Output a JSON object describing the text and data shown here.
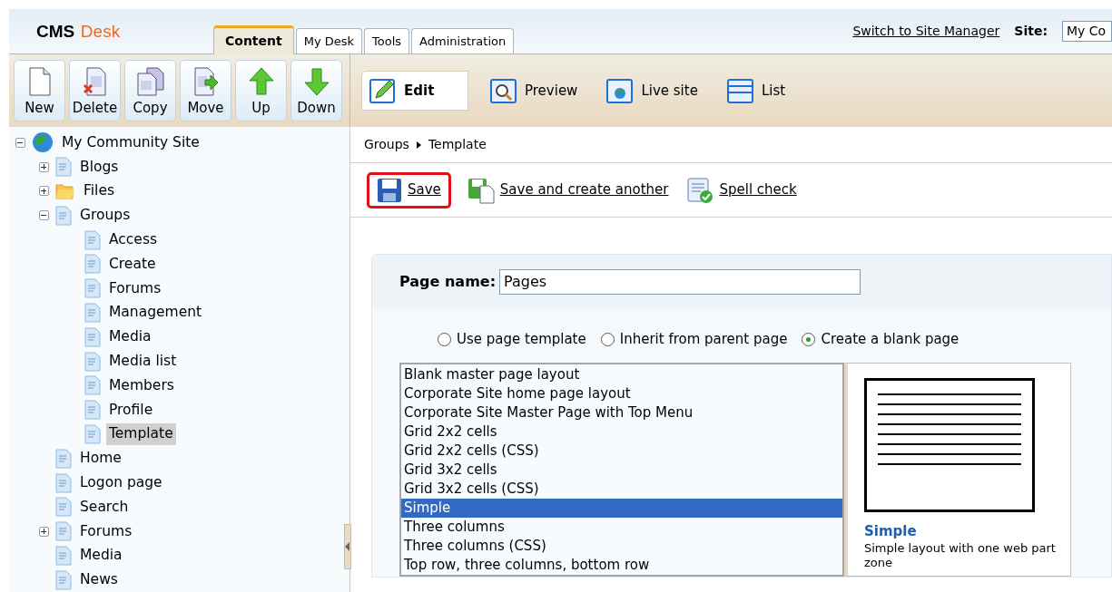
{
  "header": {
    "logo_primary": "CMS",
    "logo_secondary": "Desk",
    "tabs": [
      {
        "label": "Content",
        "selected": true
      },
      {
        "label": "My Desk",
        "selected": false
      },
      {
        "label": "Tools",
        "selected": false
      },
      {
        "label": "Administration",
        "selected": false
      }
    ],
    "switch_link": "Switch to Site Manager",
    "site_label": "Site:",
    "site_value": "My Co"
  },
  "actions": [
    {
      "kind": "new",
      "label": "New"
    },
    {
      "kind": "delete",
      "label": "Delete"
    },
    {
      "kind": "copy",
      "label": "Copy"
    },
    {
      "kind": "move",
      "label": "Move"
    },
    {
      "kind": "up",
      "label": "Up"
    },
    {
      "kind": "down",
      "label": "Down"
    }
  ],
  "view_tabs": [
    {
      "kind": "edit",
      "label": "Edit",
      "selected": true
    },
    {
      "kind": "preview",
      "label": "Preview",
      "selected": false
    },
    {
      "kind": "live",
      "label": "Live site",
      "selected": false
    },
    {
      "kind": "list",
      "label": "List",
      "selected": false
    }
  ],
  "tree": [
    {
      "label": "My Community Site",
      "kind": "globe",
      "expanded": true,
      "selected": false,
      "children": [
        {
          "label": "Blogs",
          "kind": "page",
          "expanded": false,
          "selected": false
        },
        {
          "label": "Files",
          "kind": "folder",
          "expanded": false,
          "selected": false
        },
        {
          "label": "Groups",
          "kind": "page",
          "expanded": true,
          "selected": false,
          "children": [
            {
              "label": "Access",
              "kind": "page",
              "selected": false
            },
            {
              "label": "Create",
              "kind": "page",
              "selected": false
            },
            {
              "label": "Forums",
              "kind": "page",
              "selected": false
            },
            {
              "label": "Management",
              "kind": "page",
              "selected": false
            },
            {
              "label": "Media",
              "kind": "page",
              "selected": false
            },
            {
              "label": "Media list",
              "kind": "page",
              "selected": false
            },
            {
              "label": "Members",
              "kind": "page",
              "selected": false
            },
            {
              "label": "Profile",
              "kind": "page",
              "selected": false
            },
            {
              "label": "Template",
              "kind": "page",
              "selected": true
            }
          ]
        },
        {
          "label": "Home",
          "kind": "page",
          "selected": false
        },
        {
          "label": "Logon page",
          "kind": "page",
          "selected": false
        },
        {
          "label": "Search",
          "kind": "page",
          "selected": false
        },
        {
          "label": "Forums",
          "kind": "page",
          "expanded": false,
          "selected": false
        },
        {
          "label": "Media",
          "kind": "page",
          "selected": false
        },
        {
          "label": "News",
          "kind": "page",
          "selected": false
        }
      ]
    }
  ],
  "breadcrumb": [
    "Groups",
    "Template"
  ],
  "edit_actions": [
    {
      "kind": "save",
      "label": "Save",
      "highlighted": true
    },
    {
      "kind": "save_another",
      "label": "Save and create another",
      "highlighted": false
    },
    {
      "kind": "spell",
      "label": "Spell check",
      "highlighted": false
    }
  ],
  "form": {
    "page_name_label": "Page name:",
    "page_name_value": "Pages",
    "options": [
      {
        "label": "Use page template",
        "selected": false
      },
      {
        "label": "Inherit from parent page",
        "selected": false
      },
      {
        "label": "Create a blank page",
        "selected": true
      }
    ],
    "layouts": [
      {
        "label": "Blank master page layout",
        "selected": false
      },
      {
        "label": "Corporate Site home page layout",
        "selected": false
      },
      {
        "label": "Corporate Site Master Page with Top Menu",
        "selected": false
      },
      {
        "label": "Grid 2x2 cells",
        "selected": false
      },
      {
        "label": "Grid 2x2 cells (CSS)",
        "selected": false
      },
      {
        "label": "Grid 3x2 cells",
        "selected": false
      },
      {
        "label": "Grid 3x2 cells (CSS)",
        "selected": false
      },
      {
        "label": "Simple",
        "selected": true
      },
      {
        "label": "Three columns",
        "selected": false
      },
      {
        "label": "Three columns (CSS)",
        "selected": false
      },
      {
        "label": "Top row, three columns, bottom row",
        "selected": false
      }
    ],
    "preview_title": "Simple",
    "preview_description": "Simple layout with one web part zone"
  }
}
